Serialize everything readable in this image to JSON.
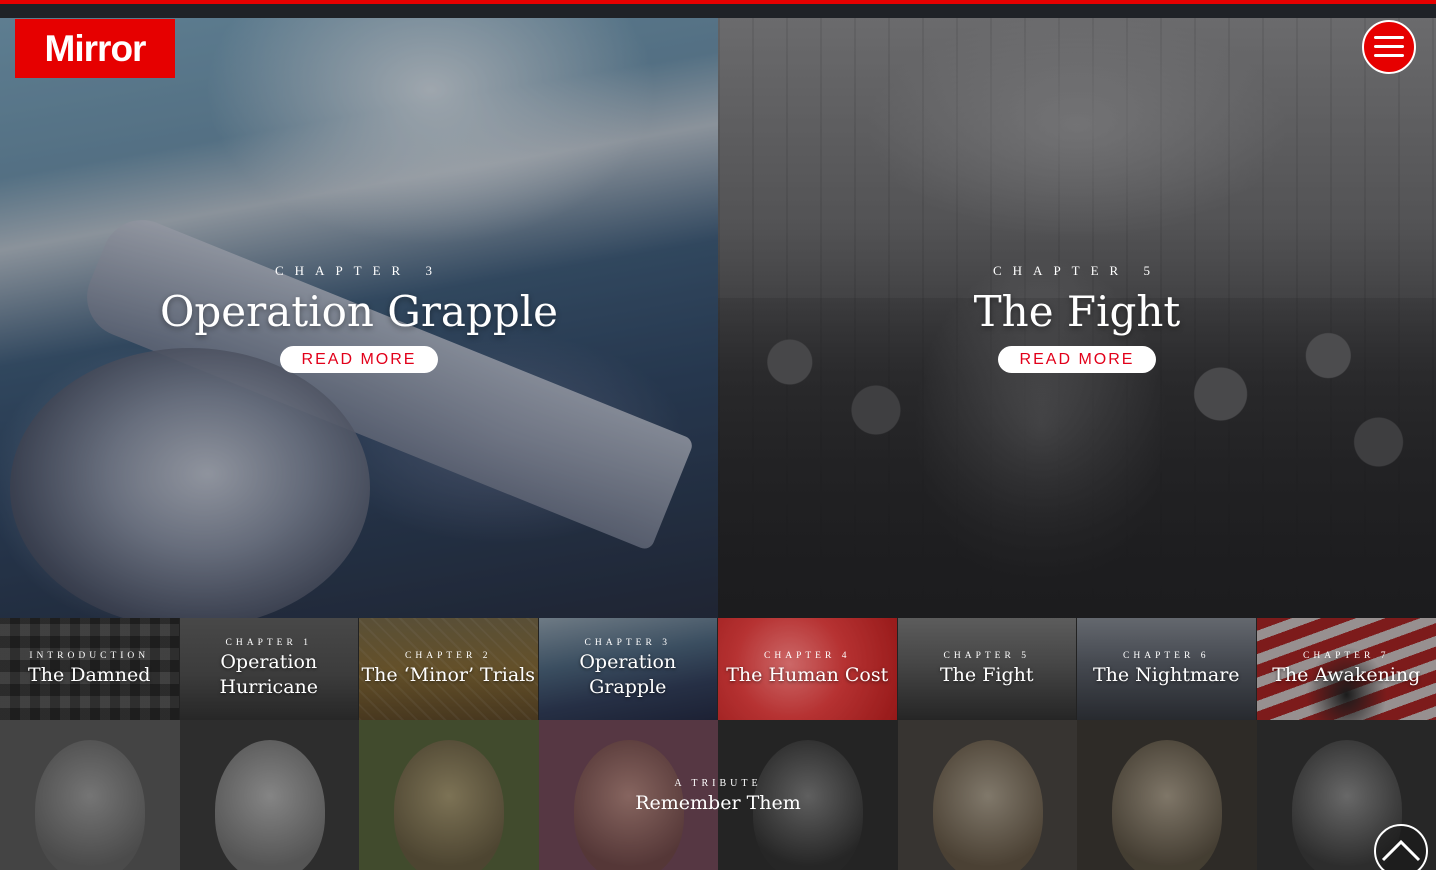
{
  "brand": {
    "logo_text": "Mirror",
    "accent": "#e60000",
    "button_text_color": "#e2001a"
  },
  "menu": {
    "icon": "hamburger-icon"
  },
  "heroes": [
    {
      "kicker": "CHAPTER 3",
      "title": "Operation Grapple",
      "cta": "READ MORE"
    },
    {
      "kicker": "CHAPTER 5",
      "title": "The Fight",
      "cta": "READ MORE"
    }
  ],
  "chapters": [
    {
      "kicker": "INTRODUCTION",
      "title": "The Damned"
    },
    {
      "kicker": "CHAPTER 1",
      "title": "Operation Hurricane"
    },
    {
      "kicker": "CHAPTER 2",
      "title": "The ‘Minor’ Trials"
    },
    {
      "kicker": "CHAPTER 3",
      "title": "Operation Grapple"
    },
    {
      "kicker": "CHAPTER 4",
      "title": "The Human Cost"
    },
    {
      "kicker": "CHAPTER 5",
      "title": "The Fight"
    },
    {
      "kicker": "CHAPTER 6",
      "title": "The Nightmare"
    },
    {
      "kicker": "CHAPTER 7",
      "title": "The Awakening"
    }
  ],
  "tribute": {
    "kicker": "A TRIBUTE",
    "title": "Remember Them"
  },
  "scroll_top": {
    "icon": "chevron-up-icon"
  }
}
